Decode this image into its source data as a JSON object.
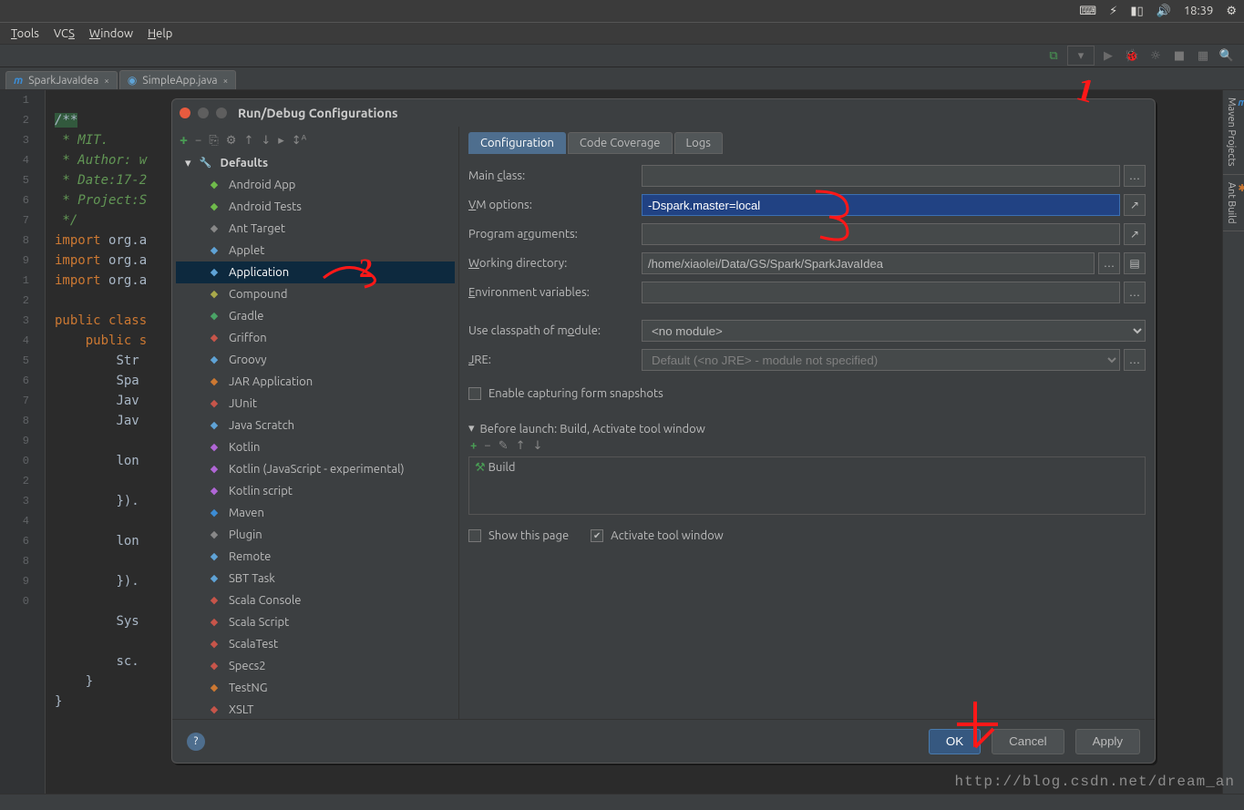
{
  "ubuntu": {
    "clock": "18:39"
  },
  "menu": {
    "tools": "Tools",
    "vcs": "VCS",
    "window": "Window",
    "help": "Help"
  },
  "tabs": {
    "t1": "SparkJavaIdea",
    "t2": "SimpleApp.java"
  },
  "rail": {
    "maven": "Maven Projects",
    "ant": "Ant Build"
  },
  "code": {
    "l1": "/**",
    "l2": " * MIT.",
    "l3": " * Author: w",
    "l4": " * Date:17-2",
    "l5": " * Project:S",
    "l6": " */",
    "l7a": "import",
    "l7b": " org.a",
    "l8a": "import",
    "l8b": " org.a",
    "l9a": "import",
    "l9b": " org.a",
    "l11a": "public class",
    "l12a": "public s",
    "l13": "Str",
    "l14": "Spa",
    "l15": "Jav",
    "l16": "Jav",
    "l18": "lon",
    "l20": "}).",
    "l22": "lon",
    "l24": "}).",
    "l26": "Sys",
    "l28": "sc.",
    "l29": "}",
    "l30": "}"
  },
  "gutter": [
    "1",
    "2",
    "3",
    "4",
    "5",
    "6",
    "7",
    "8",
    "9",
    "",
    "1",
    "2",
    "3",
    "4",
    "5",
    "6",
    "7",
    "8",
    "9",
    "0",
    "",
    "2",
    "3",
    "4",
    "",
    "6",
    "",
    "8",
    "9",
    "0"
  ],
  "dialog": {
    "title": "Run/Debug Configurations",
    "tree_root": "Defaults",
    "items": [
      "Android App",
      "Android Tests",
      "Ant Target",
      "Applet",
      "Application",
      "Compound",
      "Gradle",
      "Griffon",
      "Groovy",
      "JAR Application",
      "JUnit",
      "Java Scratch",
      "Kotlin",
      "Kotlin (JavaScript - experimental)",
      "Kotlin script",
      "Maven",
      "Plugin",
      "Remote",
      "SBT Task",
      "Scala Console",
      "Scala Script",
      "ScalaTest",
      "Specs2",
      "TestNG",
      "XSLT"
    ],
    "tabs": {
      "t1": "Configuration",
      "t2": "Code Coverage",
      "t3": "Logs"
    },
    "fields": {
      "main_class_label": "Main class:",
      "vm_options_label": "VM options:",
      "vm_options_value": "-Dspark.master=local",
      "prog_args_label": "Program arguments:",
      "workdir_label": "Working directory:",
      "workdir_value": "/home/xiaolei/Data/GS/Spark/SparkJavaIdea",
      "env_label": "Environment variables:",
      "classpath_label": "Use classpath of module:",
      "classpath_value": "<no module>",
      "jre_label": "JRE:",
      "jre_value": "Default (<no JRE> - module not specified)",
      "snapshot_label": "Enable capturing form snapshots",
      "before_label": "Before launch: Build, Activate tool window",
      "build_item": "Build",
      "show_page": "Show this page",
      "activate_win": "Activate tool window"
    },
    "buttons": {
      "ok": "OK",
      "cancel": "Cancel",
      "apply": "Apply"
    }
  },
  "watermark": "http://blog.csdn.net/dream_an",
  "annos": {
    "a1": "1",
    "a2": "2",
    "a3": "3",
    "a4": "4"
  }
}
